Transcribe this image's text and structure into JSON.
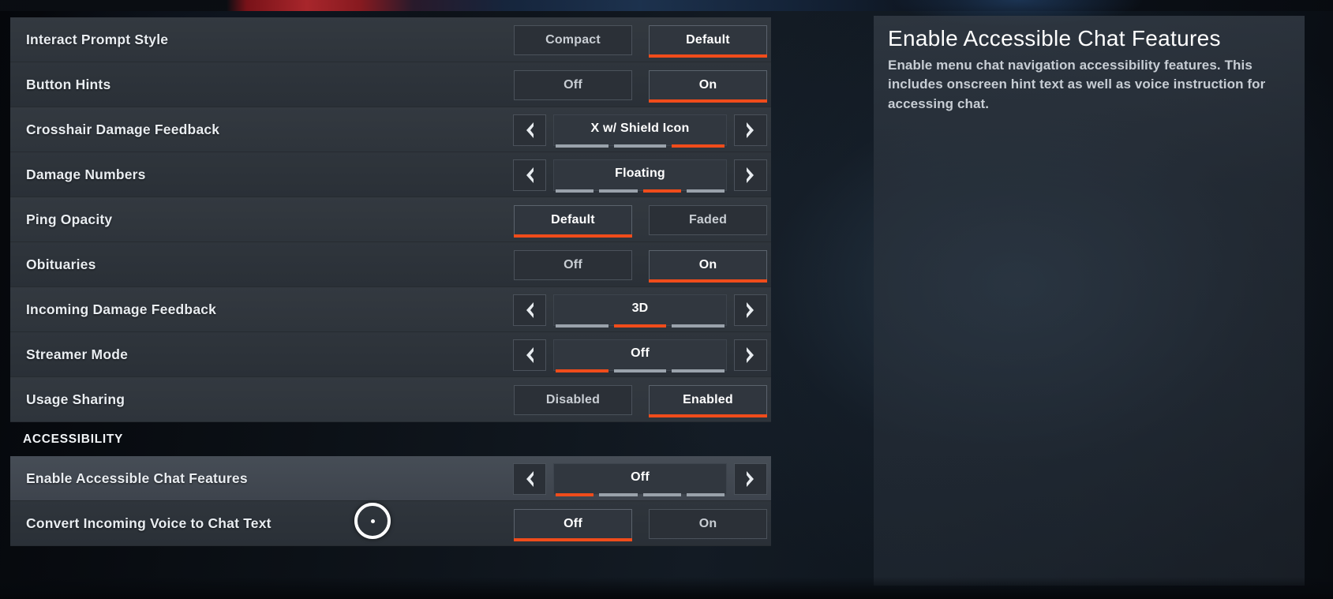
{
  "accent_color": "#f04c1b",
  "panel_bg_color": "#2f353c",
  "row_hover_color": "#464d56",
  "text_color": "#e9edf1",
  "settings": {
    "rows": [
      {
        "label": "Interact Prompt Style",
        "type": "toggle",
        "options": [
          "Compact",
          "Default"
        ],
        "selected": "Default"
      },
      {
        "label": "Button Hints",
        "type": "toggle",
        "options": [
          "Off",
          "On"
        ],
        "selected": "On"
      },
      {
        "label": "Crosshair Damage Feedback",
        "type": "stepper",
        "value": "X w/ Shield Icon",
        "segments": 3,
        "active_segment": 3
      },
      {
        "label": "Damage Numbers",
        "type": "stepper",
        "value": "Floating",
        "segments": 4,
        "active_segment": 3
      },
      {
        "label": "Ping Opacity",
        "type": "toggle",
        "options": [
          "Default",
          "Faded"
        ],
        "selected": "Default"
      },
      {
        "label": "Obituaries",
        "type": "toggle",
        "options": [
          "Off",
          "On"
        ],
        "selected": "On"
      },
      {
        "label": "Incoming Damage Feedback",
        "type": "stepper",
        "value": "3D",
        "segments": 3,
        "active_segment": 2
      },
      {
        "label": "Streamer Mode",
        "type": "stepper",
        "value": "Off",
        "segments": 3,
        "active_segment": 1
      },
      {
        "label": "Usage Sharing",
        "type": "toggle",
        "options": [
          "Disabled",
          "Enabled"
        ],
        "selected": "Enabled"
      }
    ],
    "section_header": "ACCESSIBILITY",
    "accessibility_rows": [
      {
        "label": "Enable Accessible Chat Features",
        "type": "stepper",
        "value": "Off",
        "segments": 4,
        "active_segment": 1,
        "hovered": true
      },
      {
        "label": "Convert Incoming Voice to Chat Text",
        "type": "toggle",
        "options": [
          "Off",
          "On"
        ],
        "selected": "Off"
      }
    ]
  },
  "description": {
    "title": "Enable Accessible Chat Features",
    "body": "Enable menu chat navigation accessibility features. This includes onscreen hint text as well as voice instruction for accessing chat."
  },
  "icons": {
    "left_arrow": "chevron-left-icon",
    "right_arrow": "chevron-right-icon",
    "cursor": "crosshair-cursor"
  }
}
